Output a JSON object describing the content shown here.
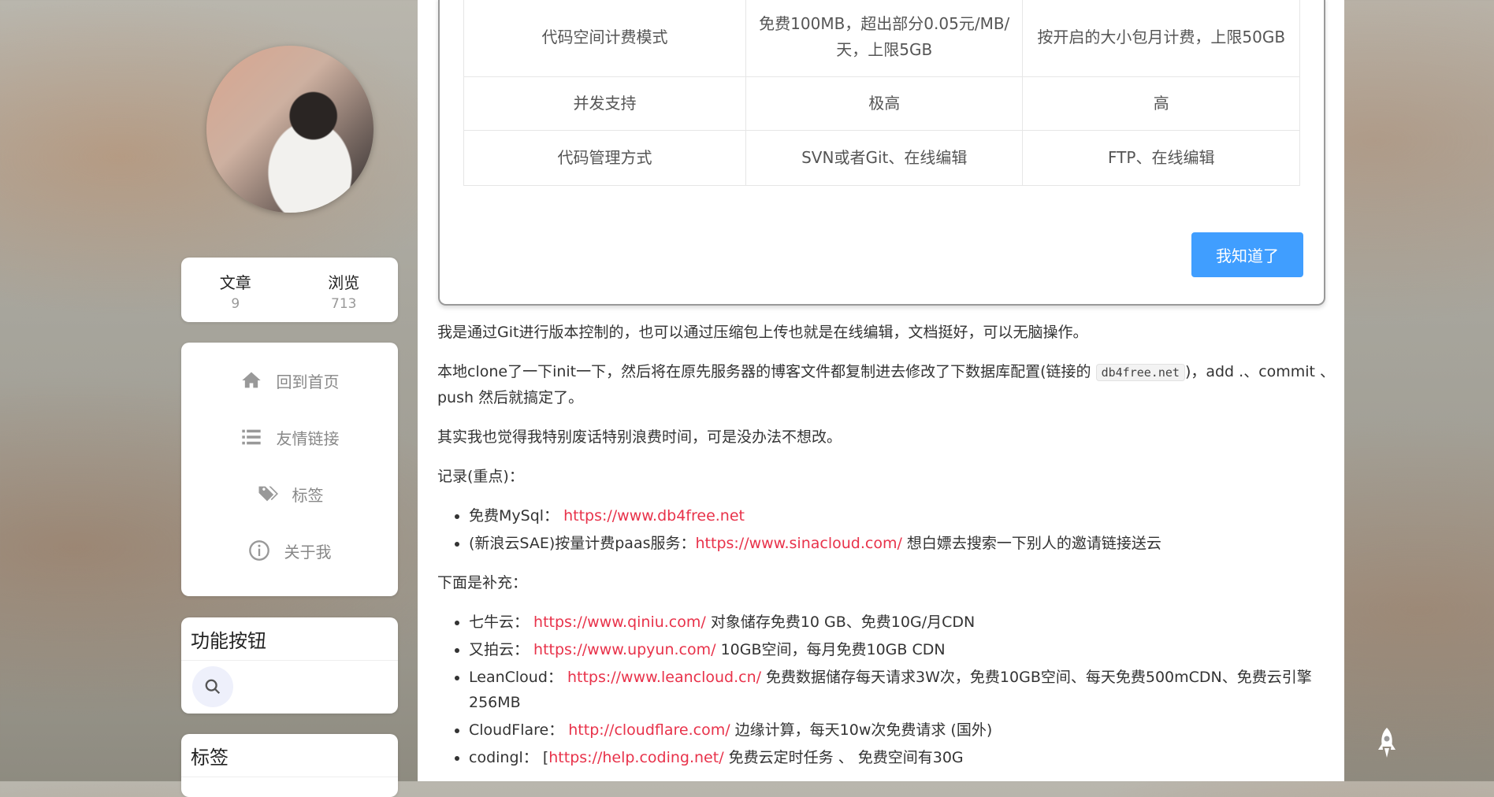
{
  "profile": {
    "avatar_alt": "头像"
  },
  "stats": [
    {
      "label": "文章",
      "value": "9"
    },
    {
      "label": "浏览",
      "value": "713"
    }
  ],
  "menu": [
    {
      "label": "回到首页",
      "icon": "home-icon"
    },
    {
      "label": "友情链接",
      "icon": "list-icon"
    },
    {
      "label": "标签",
      "icon": "tags-icon"
    },
    {
      "label": "关于我",
      "icon": "info-icon"
    }
  ],
  "func_panel": {
    "title": "功能按钮",
    "search_icon": "search-icon"
  },
  "tags_panel": {
    "title": "标签"
  },
  "dialog": {
    "rows": [
      [
        "代码空间计费模式",
        "免费100MB，超出部分0.05元/MB/天，上限5GB",
        "按开启的大小包月计费，上限50GB"
      ],
      [
        "并发支持",
        "极高",
        "高"
      ],
      [
        "代码管理方式",
        "SVN或者Git、在线编辑",
        "FTP、在线编辑"
      ]
    ],
    "ok_label": "我知道了"
  },
  "article": {
    "p1": "我是通过Git进行版本控制的，也可以通过压缩包上传也就是在线编辑，文档挺好，可以无脑操作。",
    "p2_before": "本地clone了一下init一下，然后将在原先服务器的博客文件都复制进去修改了下数据库配置(链接的 ",
    "p2_code": "db4free.net",
    "p2_after": ")，add .、commit 、push 然后就搞定了。",
    "p3": "其实我也觉得我特别废话特别浪费时间，可是没办法不想改。",
    "record_title": "记录(重点)：",
    "record_items": [
      {
        "prefix": "免费MySql： ",
        "link": "https://www.db4free.net",
        "suffix": ""
      },
      {
        "prefix": "(新浪云SAE)按量计费paas服务：",
        "link": "https://www.sinacloud.com/",
        "suffix": " 想白嫖去搜索一下别人的邀请链接送云"
      }
    ],
    "extra_title": "下面是补充：",
    "extra_items": [
      {
        "prefix": "七牛云： ",
        "link": "https://www.qiniu.com/",
        "suffix": " 对象储存免费10 GB、免费10G/月CDN"
      },
      {
        "prefix": "又拍云： ",
        "link": "https://www.upyun.com/",
        "suffix": " 10GB空间，每月免费10GB CDN"
      },
      {
        "prefix": "LeanCloud： ",
        "link": "https://www.leancloud.cn/",
        "suffix": " 免费数据储存每天请求3W次，免费10GB空间、每天免费500mCDN、免费云引擎256MB"
      },
      {
        "prefix": "CloudFlare： ",
        "link": "http://cloudflare.com/",
        "suffix": " 边缘计算，每天10w次免费请求 (国外)"
      },
      {
        "prefix": "codingl：  [",
        "link": "https://help.coding.net/",
        "suffix": " 免费云定时任务 、 免费空间有30G"
      }
    ]
  },
  "colors": {
    "accent": "#409eff",
    "link": "#e8324a"
  }
}
